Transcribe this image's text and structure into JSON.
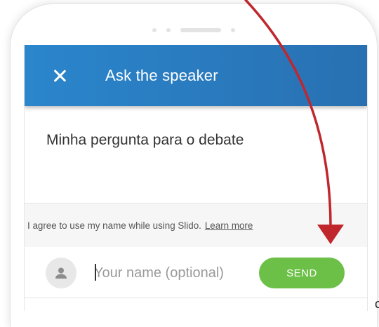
{
  "app": {
    "header": {
      "title": "Ask the speaker",
      "close_icon": "close-icon"
    },
    "question": {
      "value": "Minha pergunta para o debate"
    },
    "consent": {
      "text": "I agree to use my name while using Slido.",
      "link_label": "Learn more"
    },
    "name": {
      "placeholder": "Your name (optional)",
      "value": "",
      "avatar_icon": "user-icon"
    },
    "send_label": "SEND"
  },
  "annotation": {
    "arrow_color": "#c0272d"
  },
  "colors": {
    "header": "#2a7fc4",
    "send": "#6cc047",
    "consent_bg": "#f6f6f6"
  },
  "overflow_glyph": "c"
}
